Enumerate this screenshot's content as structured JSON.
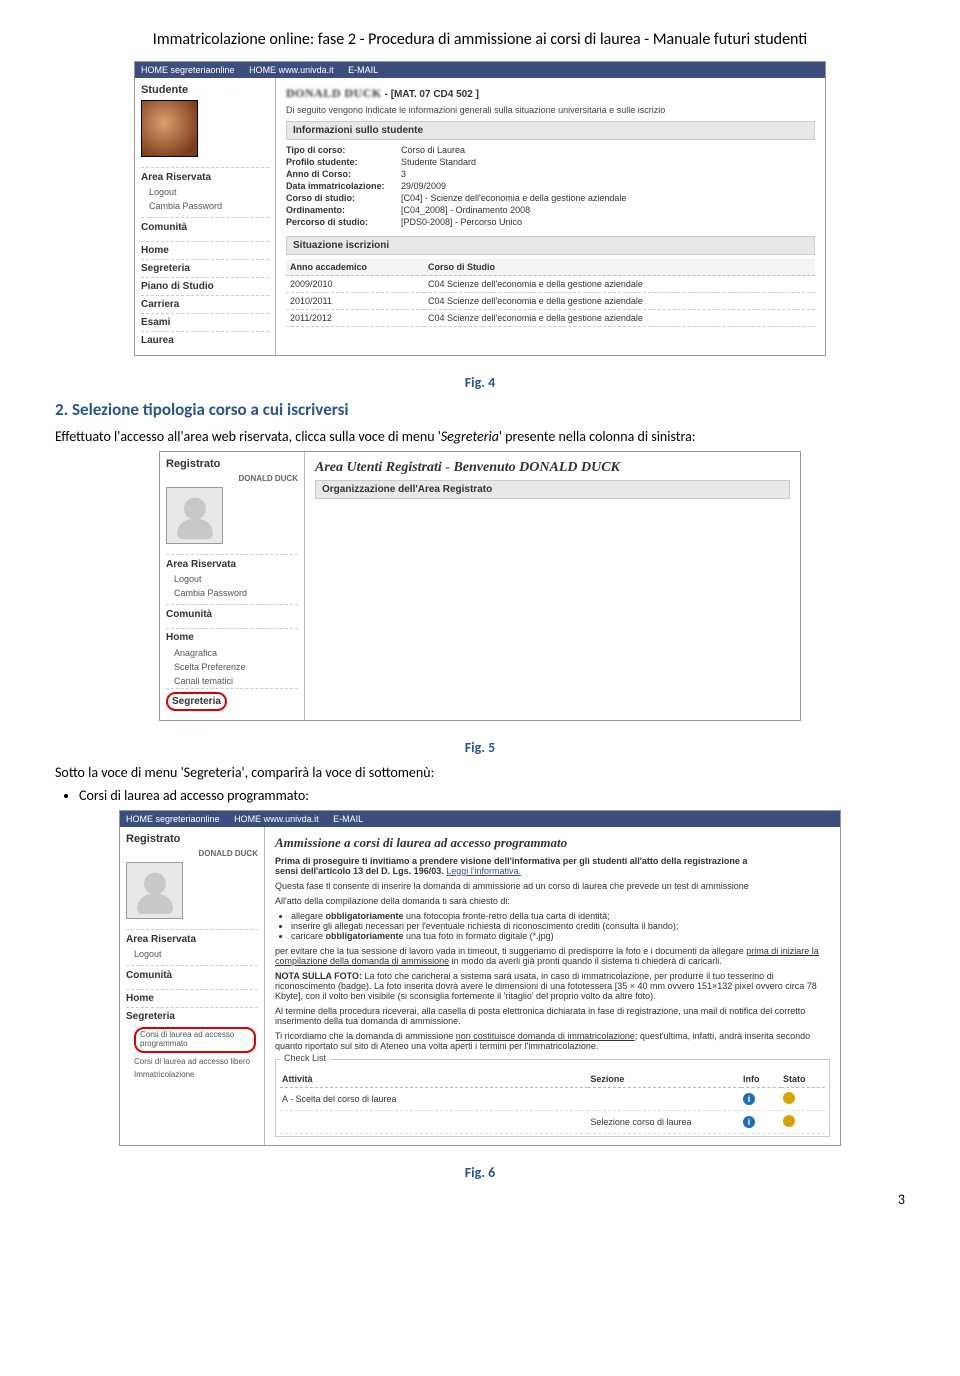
{
  "doc_title": "Immatricolazione online: fase 2 - Procedura di ammissione ai corsi di laurea - Manuale futuri studenti",
  "page_number": "3",
  "fig4_caption": "Fig. 4",
  "section2_heading": "2. Selezione tipologia corso a cui iscriversi",
  "section2_p1_a": "Effettuato l'accesso all'area web riservata, clicca sulla voce di menu '",
  "section2_p1_em": "Segreteria",
  "section2_p1_b": "' presente nella colonna di sinistra:",
  "fig5_caption": "Fig. 5",
  "p_sotto": "Sotto la voce di menu 'Segreteria', comparirà la voce di sottomenù:",
  "bullet_corsi": "Corsi di laurea ad accesso programmato:",
  "fig6_caption": "Fig. 6",
  "shot1": {
    "topbar": {
      "a": "HOME segreteriaonline",
      "b": "HOME www.univda.it",
      "c": "E-MAIL"
    },
    "side": {
      "title": "Studente",
      "sub": "",
      "area": "Area Riservata",
      "logout": "Logout",
      "cambia": "Cambia Password",
      "comunita": "Comunità",
      "nav": [
        "Home",
        "Segreteria",
        "Piano di Studio",
        "Carriera",
        "Esami",
        "Laurea"
      ]
    },
    "main": {
      "name_blur": "DONALD DUCK",
      "mat": " - [MAT. 07 CD4 502 ]",
      "desc": "Di seguito vengono indicate le informazioni generali sulla situazione universitaria e sulle iscrizio",
      "bar_info": "Informazioni sullo studente",
      "rows": [
        {
          "l": "Tipo di corso:",
          "v": "Corso di Laurea"
        },
        {
          "l": "Profilo studente:",
          "v": "Studente Standard"
        },
        {
          "l": "Anno di Corso:",
          "v": "3"
        },
        {
          "l": "Data immatricolazione:",
          "v": "29/09/2009"
        },
        {
          "l": "Corso di studio:",
          "v": "[C04] - Scienze dell'economia e della gestione aziendale"
        },
        {
          "l": "Ordinamento:",
          "v": "[C04_2008] - Ordinamento 2008"
        },
        {
          "l": "Percorso di studio:",
          "v": "[PDS0-2008] - Percorso Unico"
        }
      ],
      "bar_sit": "Situazione iscrizioni",
      "th_anno": "Anno accademico",
      "th_corso": "Corso di Studio",
      "tab": [
        {
          "a": "2009/2010",
          "c": "C04 Scienze dell'economia e della gestione aziendale"
        },
        {
          "a": "2010/2011",
          "c": "C04 Scienze dell'economia e della gestione aziendale"
        },
        {
          "a": "2011/2012",
          "c": "C04 Scienze dell'economia e della gestione aziendale"
        }
      ]
    }
  },
  "shot2": {
    "side": {
      "title": "Registrato",
      "name": "DONALD DUCK",
      "area": "Area Riservata",
      "logout": "Logout",
      "cambia": "Cambia Password",
      "comunita": "Comunità",
      "nav_home": "Home",
      "nav_sub": [
        "Anagrafica",
        "Scelta Preferenze",
        "Canali tematici"
      ],
      "nav_seg": "Segreteria"
    },
    "main": {
      "h": "Area Utenti Registrati - Benvenuto DONALD DUCK",
      "bar": "Organizzazione dell'Area Registrato"
    }
  },
  "shot3": {
    "topbar": {
      "a": "HOME segreteriaonline",
      "b": "HOME www.univda.it",
      "c": "E-MAIL"
    },
    "side": {
      "title": "Registrato",
      "name": "DONALD DUCK",
      "area": "Area Riservata",
      "logout": "Logout",
      "comunita": "Comunità",
      "nav_home": "Home",
      "nav_seg": "Segreteria",
      "nav_circled": "Corsi di laurea ad accesso programmato",
      "nav_sub": [
        "Corsi di laurea ad accesso libero",
        "Immatricolazione"
      ]
    },
    "main": {
      "h": "Ammissione a corsi di laurea ad accesso programmato",
      "p0a": "Prima di proseguire ti invitiamo a prendere visione dell'informativa per gli studenti all'atto della registrazione a",
      "p0b": "sensi dell'articolo 13 del D. Lgs. 196/03. ",
      "p0link": "Leggi l'informativa.",
      "p1": "Questa fase ti consente di inserire la domanda di ammissione ad un corso di laurea che prevede un test di ammissione",
      "p2": "All'atto della compilazione della domanda ti sarà chiesto di:",
      "li": [
        "allegare obbligatoriamente una fotocopia fronte-retro della tua carta di identità;",
        "inserire gli allegati necessari per l'eventuale richiesta di riconoscimento crediti (consulta il bando);",
        "caricare obbligatoriamente una tua foto in formato digitale (*.jpg)"
      ],
      "p3a": "per evitare che la tua sessione di lavoro vada in timeout, ti suggeriamo di predisporre la foto e i documenti da allegare ",
      "p3u": "prima di iniziare la compilazione della domanda di ammissione",
      "p3b": " in modo da averli già pronti quando il sistema ti chiederà di caricarli.",
      "p4a": "NOTA SULLA FOTO:",
      "p4b": " La foto che caricherai a sistema sarà usata, in caso di immatricolazione, per produrre il tuo tesserino di riconoscimento (badge). La foto inserita dovrà avere le dimensioni di una fototessera [35 × 40 mm ovvero 151×132 pixel ovvero circa 78 Kbyte], con il volto ben visibile (si sconsiglia fortemente il 'ritaglio' del proprio volto da altre foto).",
      "p5": "Al termine della procedura riceverai, alla casella di posta elettronica dichiarata in fase di registrazione, una mail di notifica del corretto inserimento della tua domanda di ammissione.",
      "p6a": "Ti ricordiamo che la domanda di ammissione ",
      "p6u": "non costituisce domanda di immatricolazione",
      "p6b": "; quest'ultima, infatti, andrà inserita secondo quanto riportato sul sito di Ateneo una volta aperti i termini per l'immatricolazione.",
      "legend": "Check List",
      "th_att": "Attività",
      "th_sez": "Sezione",
      "th_info": "Info",
      "th_stato": "Stato",
      "row_a": "A - Scelta del corso di laurea",
      "row_b": "Selezione corso di laurea"
    }
  }
}
